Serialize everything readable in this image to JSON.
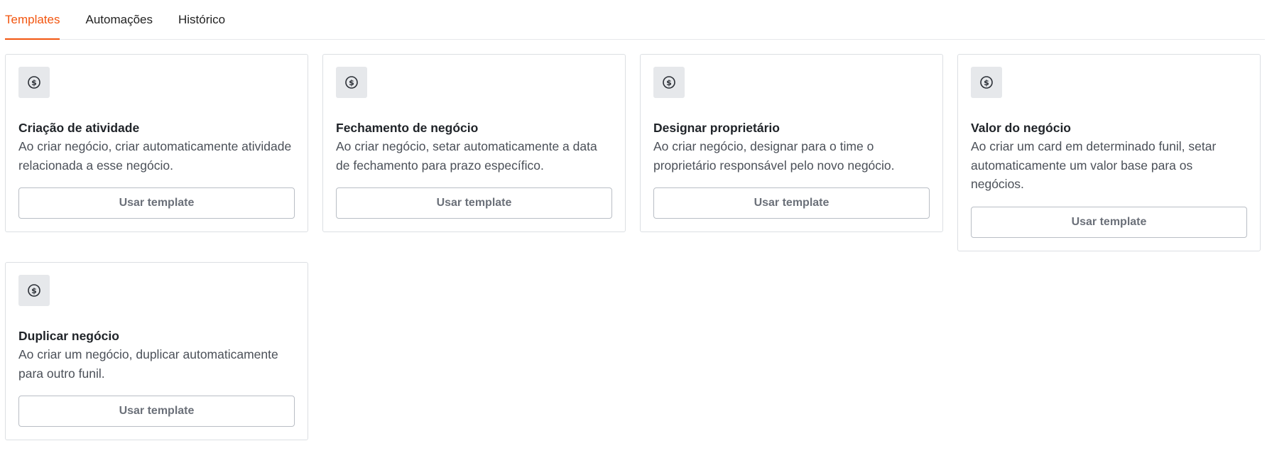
{
  "tabs": [
    {
      "label": "Templates",
      "active": true
    },
    {
      "label": "Automações",
      "active": false
    },
    {
      "label": "Histórico",
      "active": false
    }
  ],
  "accent_color": "#f2550f",
  "cards": [
    {
      "icon": "dollar-circle-icon",
      "title": "Criação de atividade",
      "description": "Ao criar negócio, criar automaticamente atividade relacionada a esse negócio.",
      "button_label": "Usar template"
    },
    {
      "icon": "dollar-circle-icon",
      "title": "Fechamento de negócio",
      "description": "Ao criar negócio, setar automaticamente a data de fechamento para prazo específico.",
      "button_label": "Usar template"
    },
    {
      "icon": "dollar-circle-icon",
      "title": "Designar proprietário",
      "description": "Ao criar negócio, designar para o time o proprietário responsável pelo novo negócio.",
      "button_label": "Usar template"
    },
    {
      "icon": "dollar-circle-icon",
      "title": "Valor do negócio",
      "description": "Ao criar um card em determinado funil, setar automaticamente um valor base para os negócios.",
      "button_label": "Usar template"
    },
    {
      "icon": "dollar-circle-icon",
      "title": "Duplicar negócio",
      "description": "Ao criar um negócio, duplicar automaticamente para outro funil.",
      "button_label": "Usar template"
    }
  ]
}
